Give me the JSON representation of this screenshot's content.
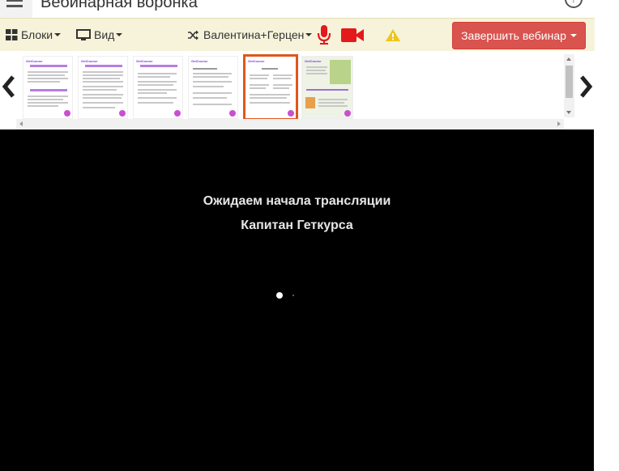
{
  "header": {
    "title": "Вебинарная воронка",
    "help_icon": "help-icon"
  },
  "toolbar": {
    "blocks_label": "Блоки",
    "view_label": "Вид",
    "presenter_label": "Валентина+Герцен",
    "finish_label": "Завершить вебинар",
    "icons": [
      "blocks-icon",
      "monitor-icon",
      "shuffle-icon",
      "microphone-icon",
      "camera-icon",
      "warning-icon"
    ],
    "colors": {
      "mic": "#e3191b",
      "camera": "#e3191b",
      "warning": "#f0c419",
      "finish_bg": "#d9534f"
    }
  },
  "slides": {
    "count": 7,
    "active_index": 5,
    "brand_text": "GetCourse"
  },
  "video": {
    "line1": "Ожидаем начала трансляции",
    "line2": "Капитан Геткурса"
  }
}
